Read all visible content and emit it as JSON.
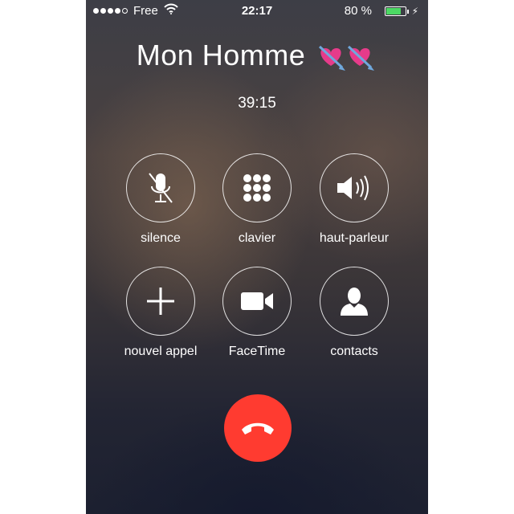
{
  "status_bar": {
    "carrier": "Free",
    "signal_bars_filled": 4,
    "signal_bars_total": 5,
    "time": "22:17",
    "battery_percent_label": "80 %",
    "battery_level": 0.8,
    "icons": [
      "wifi-icon",
      "battery-icon",
      "charging-bolt-icon"
    ]
  },
  "call": {
    "caller_name": "Mon Homme",
    "caller_emoji": [
      "heart-with-arrow-icon",
      "heart-with-arrow-icon"
    ],
    "duration": "39:15"
  },
  "controls": {
    "mute": {
      "label": "silence",
      "icon": "microphone-muted-icon"
    },
    "keypad": {
      "label": "clavier",
      "icon": "keypad-grid-icon"
    },
    "speaker": {
      "label": "haut-parleur",
      "icon": "speaker-icon"
    },
    "add_call": {
      "label": "nouvel appel",
      "icon": "plus-icon"
    },
    "facetime": {
      "label": "FaceTime",
      "icon": "video-camera-icon"
    },
    "contacts": {
      "label": "contacts",
      "icon": "person-icon"
    }
  },
  "end_call": {
    "icon": "phone-hangup-icon",
    "color": "#ff3b30"
  },
  "colors": {
    "battery_fill": "#4cd964",
    "text": "#ffffff"
  }
}
